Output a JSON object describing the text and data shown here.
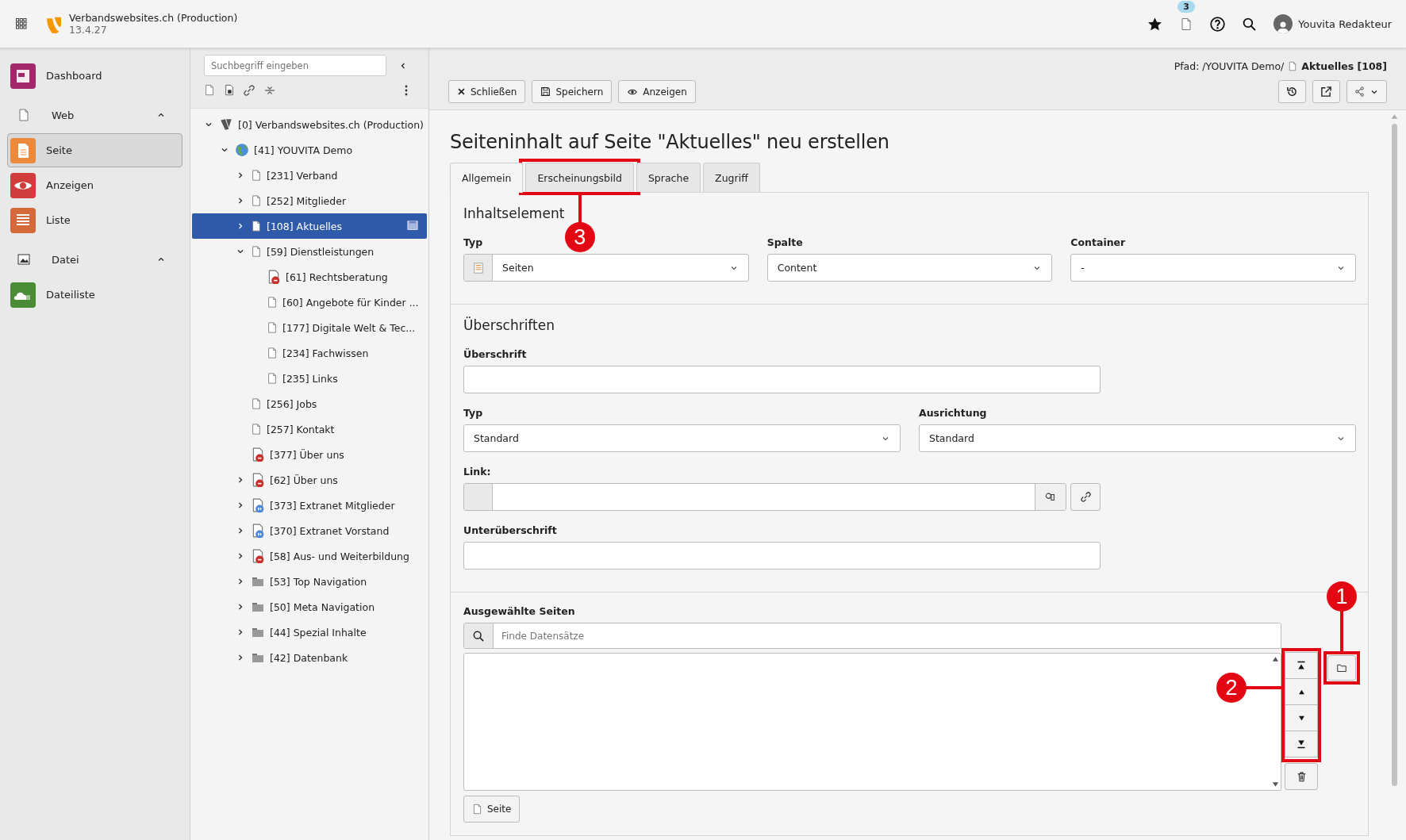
{
  "topbar": {
    "site_name": "Verbandswebsites.ch (Production)",
    "version": "13.4.27",
    "badge": "3",
    "user": "Youvita Redakteur"
  },
  "modules": [
    {
      "kind": "module",
      "label": "Dashboard",
      "color": "#a3286b",
      "selected": false
    },
    {
      "kind": "group",
      "label": "Web",
      "expanded": true
    },
    {
      "kind": "module",
      "label": "Seite",
      "color": "#eb8a3c",
      "selected": true
    },
    {
      "kind": "module",
      "label": "Anzeigen",
      "color": "#d13c3c",
      "selected": false
    },
    {
      "kind": "module",
      "label": "Liste",
      "color": "#d4693a",
      "selected": false
    },
    {
      "kind": "group",
      "label": "Datei",
      "expanded": true
    },
    {
      "kind": "module",
      "label": "Dateiliste",
      "color": "#4a8b36",
      "selected": false
    }
  ],
  "tree": {
    "placeholder": "Suchbegriff eingeben",
    "nodes": [
      {
        "label": "[0] Verbandswebsites.ch (Production)",
        "kind": "root",
        "expanded": true,
        "selected": false,
        "children": [
          {
            "label": "[41] YOUVITA Demo",
            "kind": "globe",
            "expanded": true,
            "selected": false,
            "children": [
              {
                "label": "[231] Verband",
                "kind": "page",
                "expanded": false,
                "selected": false
              },
              {
                "label": "[252] Mitglieder",
                "kind": "page",
                "expanded": false,
                "selected": false
              },
              {
                "label": "[108] Aktuelles",
                "kind": "page",
                "expanded": false,
                "selected": true
              },
              {
                "label": "[59] Dienstleistungen",
                "kind": "page",
                "expanded": true,
                "selected": false,
                "children": [
                  {
                    "label": "[61] Rechtsberatung",
                    "kind": "hidden",
                    "selected": false
                  },
                  {
                    "label": "[60] Angebote für Kinder ...",
                    "kind": "page",
                    "selected": false
                  },
                  {
                    "label": "[177] Digitale Welt & Tec...",
                    "kind": "page",
                    "selected": false
                  },
                  {
                    "label": "[234] Fachwissen",
                    "kind": "page",
                    "selected": false
                  },
                  {
                    "label": "[235] Links",
                    "kind": "page",
                    "selected": false
                  }
                ]
              },
              {
                "label": "[256] Jobs",
                "kind": "page",
                "selected": false
              },
              {
                "label": "[257] Kontakt",
                "kind": "page",
                "selected": false
              },
              {
                "label": "[377] Über uns",
                "kind": "hidden",
                "selected": false
              },
              {
                "label": "[62] Über uns",
                "kind": "hidden",
                "expanded": false,
                "selected": false
              },
              {
                "label": "[373] Extranet Mitglieder",
                "kind": "shortcut",
                "expanded": false,
                "selected": false
              },
              {
                "label": "[370] Extranet Vorstand",
                "kind": "shortcut",
                "expanded": false,
                "selected": false
              },
              {
                "label": "[58] Aus- und Weiterbildung",
                "kind": "hidden",
                "expanded": false,
                "selected": false
              },
              {
                "label": "[53] Top Navigation",
                "kind": "folder",
                "expanded": false,
                "selected": false
              },
              {
                "label": "[50] Meta Navigation",
                "kind": "folder",
                "expanded": false,
                "selected": false
              },
              {
                "label": "[44] Spezial Inhalte",
                "kind": "folder",
                "expanded": false,
                "selected": false
              },
              {
                "label": "[42] Datenbank",
                "kind": "folder",
                "expanded": false,
                "selected": false
              }
            ]
          }
        ]
      }
    ]
  },
  "docheader": {
    "path_label": "Pfad: /YOUVITA Demo/",
    "path_page": "Aktuelles [108]",
    "buttons": [
      {
        "label": "Schließen",
        "kind": "close"
      },
      {
        "label": "Speichern",
        "kind": "save"
      },
      {
        "label": "Anzeigen",
        "kind": "view"
      }
    ]
  },
  "title": "Seiteninhalt auf Seite \"Aktuelles\" neu erstellen",
  "tabs": [
    {
      "label": "Allgemein",
      "selected": true
    },
    {
      "label": "Erscheinungsbild",
      "selected": false
    },
    {
      "label": "Sprache",
      "selected": false
    },
    {
      "label": "Zugriff",
      "selected": false
    }
  ],
  "section_1": {
    "heading": "Inhaltselement",
    "fields": [
      {
        "label": "Typ",
        "value": "Seiten"
      },
      {
        "label": "Spalte",
        "value": "Content"
      },
      {
        "label": "Container",
        "value": "-"
      }
    ]
  },
  "section_2": {
    "heading": "Überschriften",
    "headline_label": "Überschrift",
    "type": {
      "label": "Typ",
      "value": "Standard"
    },
    "align": {
      "label": "Ausrichtung",
      "value": "Standard"
    },
    "link_label": "Link:",
    "subheadline_label": "Unterüberschrift"
  },
  "section_3": {
    "label": "Ausgewählte Seiten",
    "placeholder": "Finde Datensätze",
    "add_button": "Seite"
  },
  "callouts": [
    {
      "number": "1"
    },
    {
      "number": "2"
    },
    {
      "number": "3"
    }
  ]
}
